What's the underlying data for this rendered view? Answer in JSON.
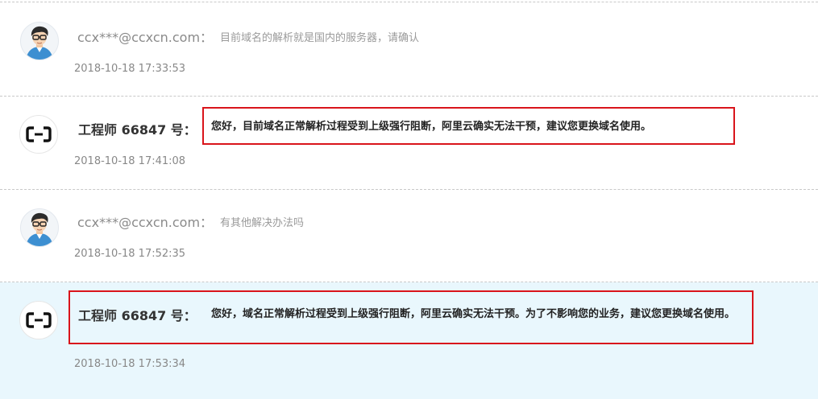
{
  "messages": [
    {
      "role": "user",
      "sender": "ccx***@ccxcn.com：",
      "text": "目前域名的解析就是国内的服务器，请确认",
      "time": "2018-10-18 17:33:53",
      "avatar": "person-glasses-icon"
    },
    {
      "role": "engineer",
      "sender": "工程师 66847 号：",
      "text": "您好，目前域名正常解析过程受到上级强行阻断，阿里云确实无法干预，建议您更换域名使用。",
      "time": "2018-10-18 17:41:08",
      "avatar": "aliyun-logo-icon",
      "highlighted_box": true
    },
    {
      "role": "user",
      "sender": "ccx***@ccxcn.com：",
      "text": "有其他解决办法吗",
      "time": "2018-10-18 17:52:35",
      "avatar": "person-glasses-icon"
    },
    {
      "role": "engineer",
      "sender": "工程师 66847 号：",
      "text": "您好，域名正常解析过程受到上级强行阻断，阿里云确实无法干预。为了不影响您的业务，建议您更换域名使用。",
      "time": "2018-10-18 17:53:34",
      "avatar": "aliyun-logo-icon",
      "highlighted_box": true,
      "row_background": "#e9f7fd"
    }
  ],
  "colors": {
    "red_box": "#d9141b",
    "highlight_bg": "#e9f7fd"
  }
}
